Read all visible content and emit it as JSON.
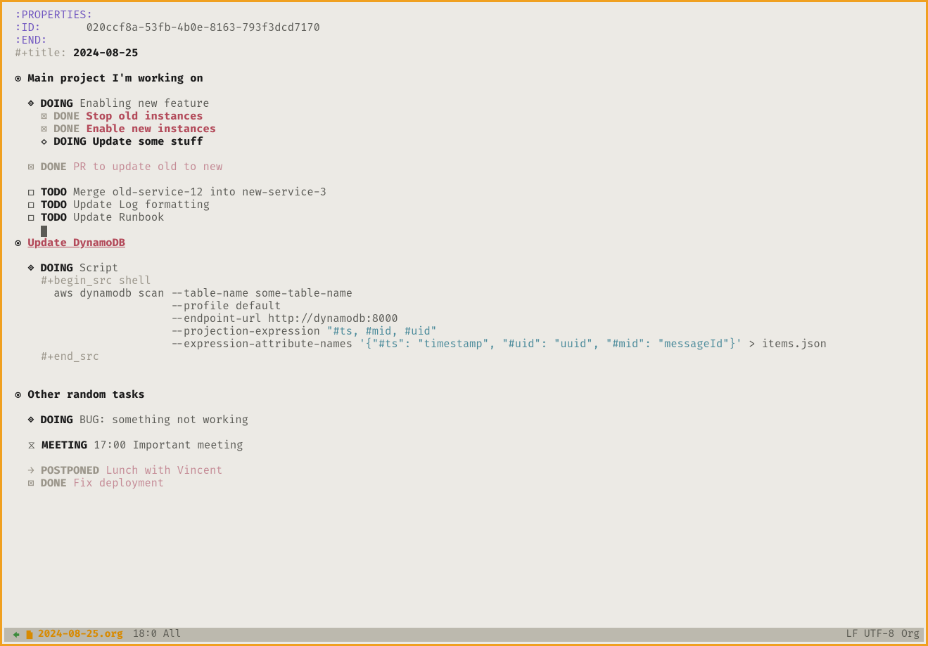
{
  "properties": {
    "properties_label": ":PROPERTIES:",
    "id_label": ":ID:",
    "id_value": "020ccf8a-53fb-4b0e-8163-793f3dcd7170",
    "end_label": ":END:"
  },
  "title": {
    "keyword": "#+title:",
    "value": "2024-08-25"
  },
  "headings": {
    "main": "Main project I'm working on",
    "update_dynamodb": "Update DynamoDB",
    "other": "Other random tasks"
  },
  "keywords": {
    "doing": "DOING",
    "done": "DONE",
    "todo": "TODO",
    "meeting": "MEETING",
    "postponed": "POSTPONED"
  },
  "bullets": {
    "lvl1": "◉",
    "lvl2": "◈",
    "lvl3_open": "◇",
    "check_done": "⊠",
    "check_todo": "☐",
    "hourglass": "⧖",
    "arrow": "→"
  },
  "tasks": {
    "enabling": "Enabling new feature",
    "stop_old": "Stop old instances",
    "enable_new": "Enable new instances",
    "update_stuff": "Update some stuff",
    "pr_update": "PR to update old to new",
    "merge": "Merge old-service-12 into new-service-3",
    "log_fmt": "Update Log formatting",
    "runbook": "Update Runbook",
    "script": "Script",
    "bug": "BUG: something not working",
    "meeting_txt": "17:00 Important meeting",
    "lunch": "Lunch with Vincent",
    "fix_deploy": "Fix deployment"
  },
  "src": {
    "begin": "#+begin_src shell",
    "l1": "aws dynamodb scan --table-name some-table-name",
    "l2": "--profile default",
    "l3": "--endpoint-url http://dynamodb:8000",
    "l4a": "--projection-expression ",
    "l4b": "\"#ts, #mid, #uid\"",
    "l5a": "--expression-attribute-names ",
    "l5b": "'{\"#ts\": \"timestamp\", \"#uid\": \"uuid\", \"#mid\": \"messageId\"}'",
    "l5c": " > items.json",
    "end": "#+end_src"
  },
  "modeline": {
    "filename": "2024-08-25.org",
    "position": "18:0 All",
    "encoding": "LF UTF-8",
    "mode": "Org"
  }
}
